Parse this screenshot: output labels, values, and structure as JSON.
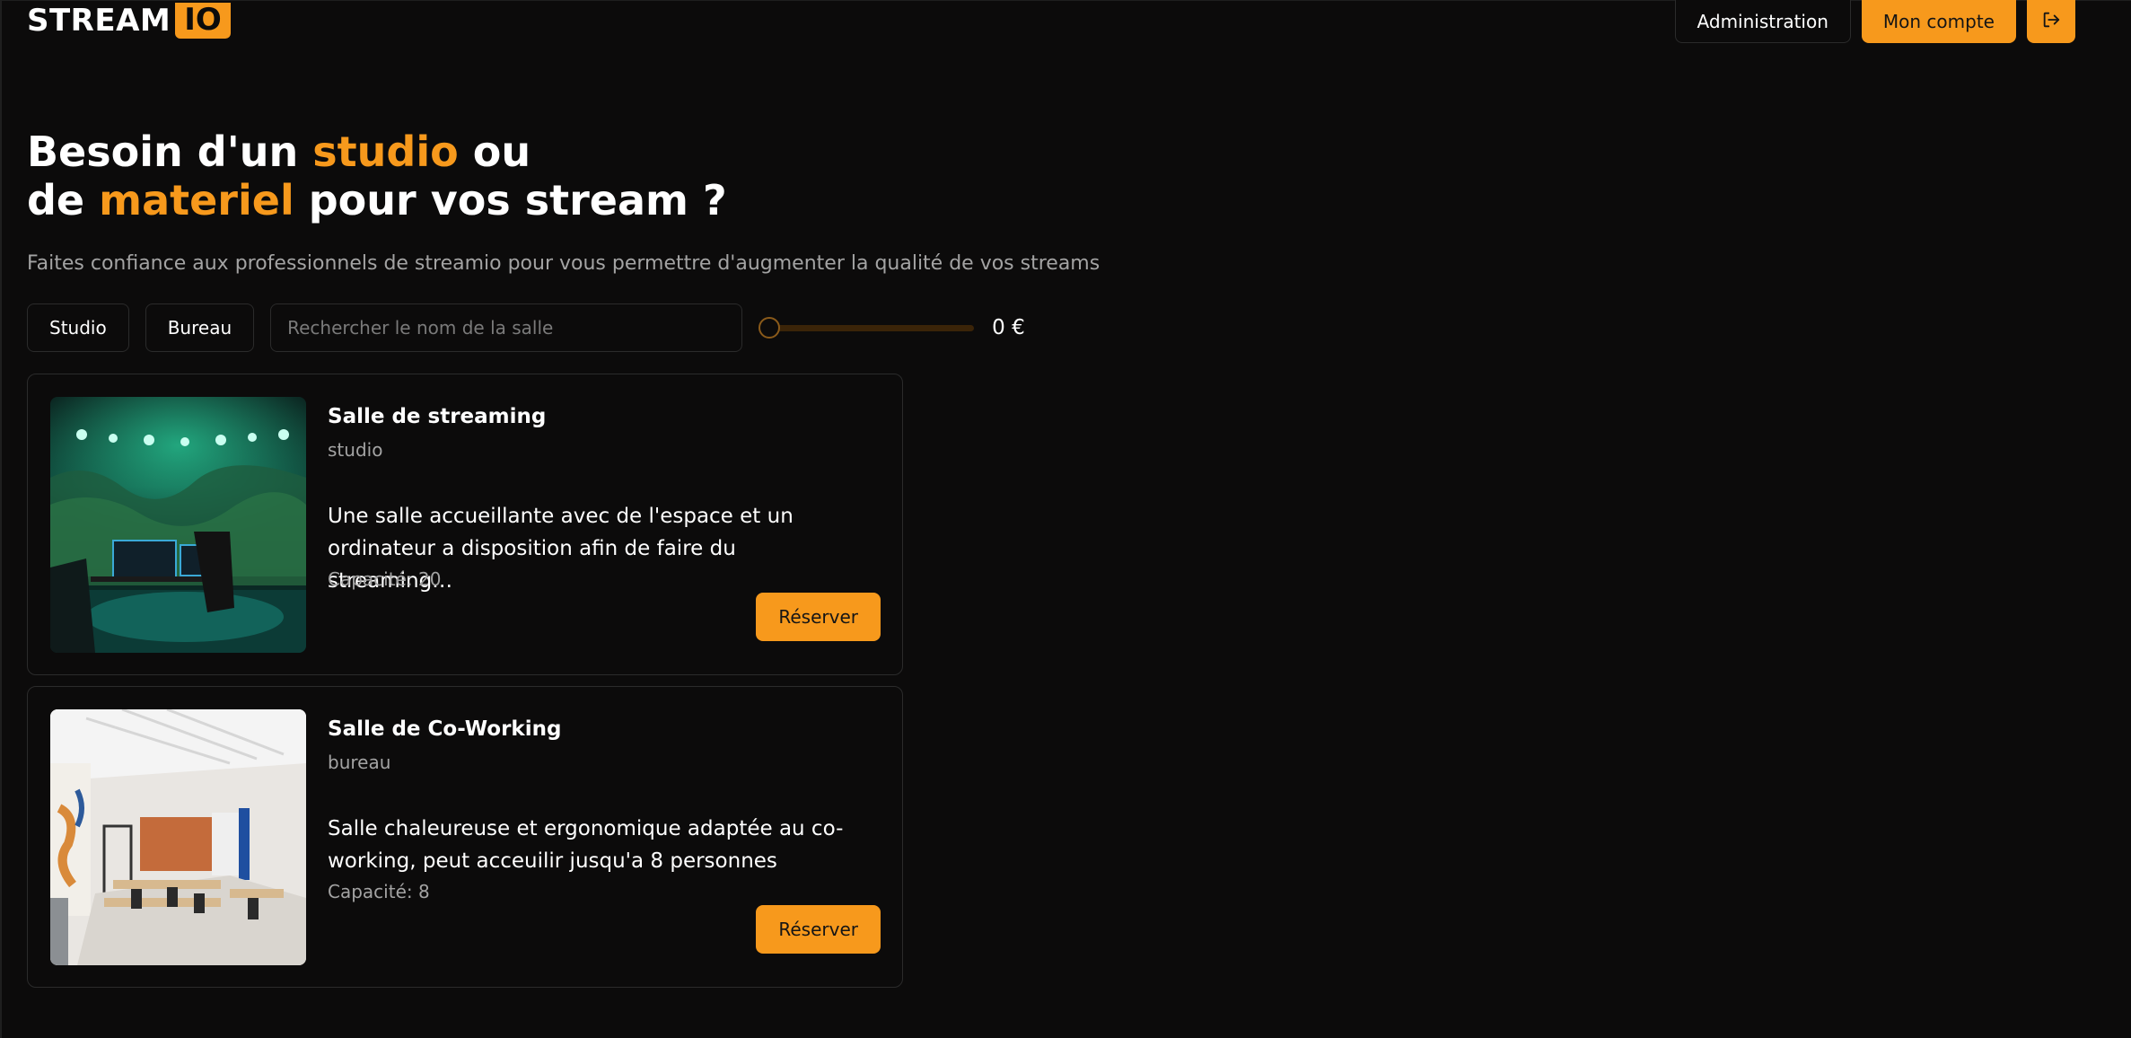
{
  "brand": {
    "word": "STREAM",
    "badge": "IO",
    "accent_color": "#f7991c"
  },
  "nav": {
    "admin_label": "Administration",
    "account_label": "Mon compte",
    "logout_icon": "logout-icon"
  },
  "hero": {
    "line1_a": "Besoin d'un ",
    "line1_accent": "studio",
    "line1_b": " ou",
    "line2_a": "de ",
    "line2_accent": "materiel",
    "line2_b": " pour vos stream ?"
  },
  "subtitle": "Faites confiance aux professionnels de streamio pour vous permettre d'augmenter la qualité de vos streams",
  "filters": {
    "chip_studio": "Studio",
    "chip_bureau": "Bureau",
    "search_placeholder": "Rechercher le nom de la salle",
    "price_value": 0,
    "price_label": "0 €"
  },
  "rooms": [
    {
      "title": "Salle de streaming",
      "type": "studio",
      "description": "Une salle accueillante avec de l'espace et un ordinateur a disposition afin de faire du streaming…",
      "capacity": "Capacité: 20",
      "button": "Réserver"
    },
    {
      "title": "Salle de Co-Working",
      "type": "bureau",
      "description": "Salle chaleureuse et ergonomique adaptée au co-working, peut acceuilir jusqu'a 8 personnes",
      "capacity": "Capacité: 8",
      "button": "Réserver"
    }
  ]
}
